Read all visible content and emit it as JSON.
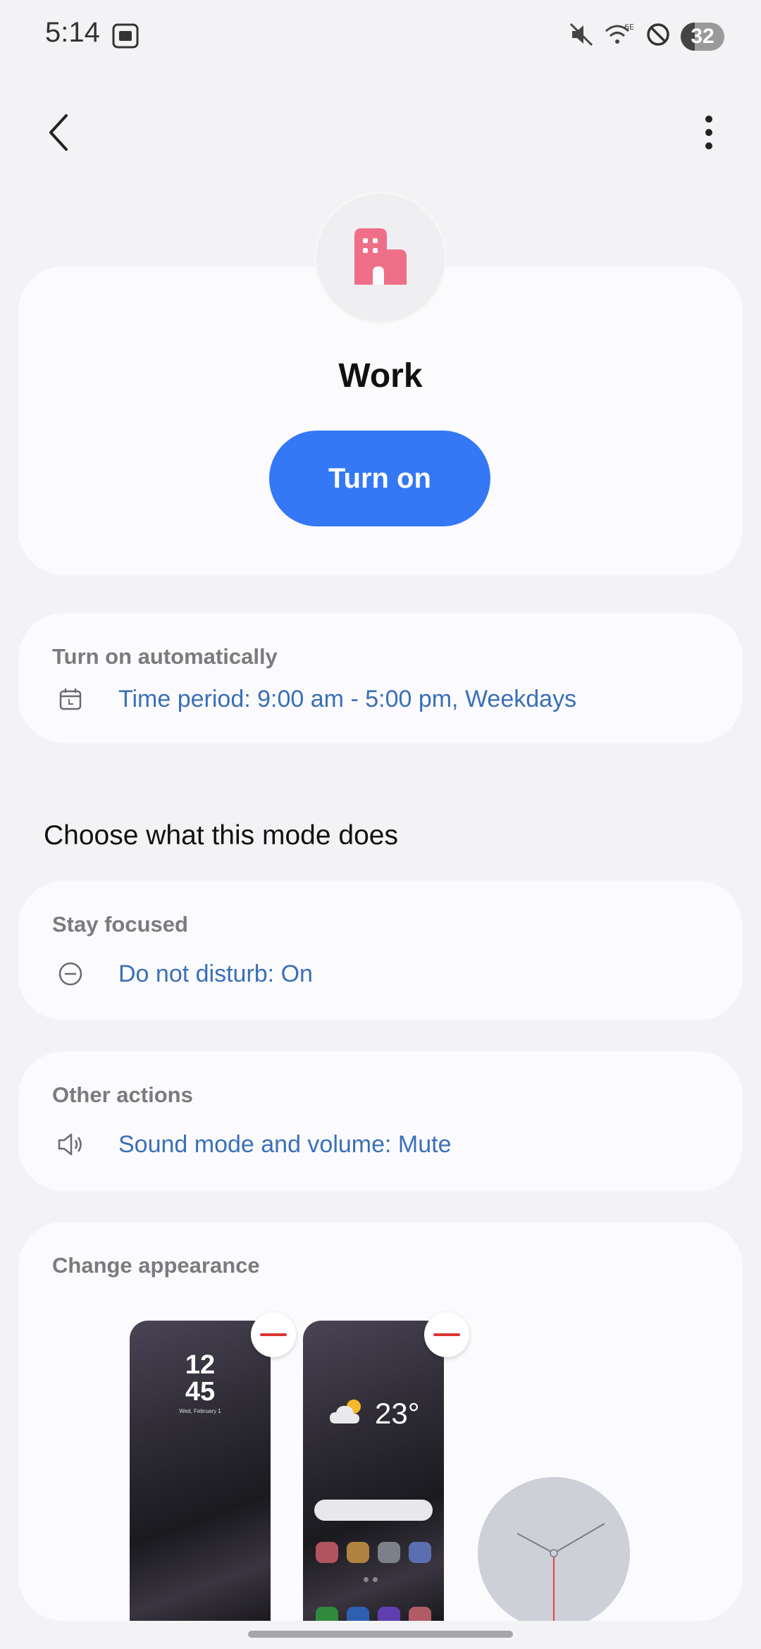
{
  "status_bar": {
    "time": "5:14",
    "battery": "32",
    "icons": [
      "screen-record-icon",
      "mute-icon",
      "wifi-6e-icon",
      "do-not-disturb-icon",
      "battery-icon"
    ]
  },
  "app_bar": {
    "back_icon": "chevron-left-icon",
    "more_icon": "more-vertical-icon"
  },
  "mode": {
    "icon": "office-building-icon",
    "icon_color": "#ee6f87",
    "name": "Work",
    "turn_on_label": "Turn on",
    "accent": "#3478f6"
  },
  "auto": {
    "label": "Turn on automatically",
    "item": "Time period: 9:00 am - 5:00 pm, Weekdays",
    "item_icon": "calendar-icon"
  },
  "section_heading": "Choose what this mode does",
  "stay_focused": {
    "label": "Stay focused",
    "item": "Do not disturb: On",
    "item_icon": "minus-circle-icon"
  },
  "other_actions": {
    "label": "Other actions",
    "item": "Sound mode and volume: Mute",
    "item_icon": "speaker-icon"
  },
  "appearance": {
    "label": "Change appearance",
    "lock_hour": "12",
    "lock_minute": "45",
    "lock_date": "Wed, February 1",
    "home_temperature": "23°",
    "link_color": "#3a6fb8"
  }
}
